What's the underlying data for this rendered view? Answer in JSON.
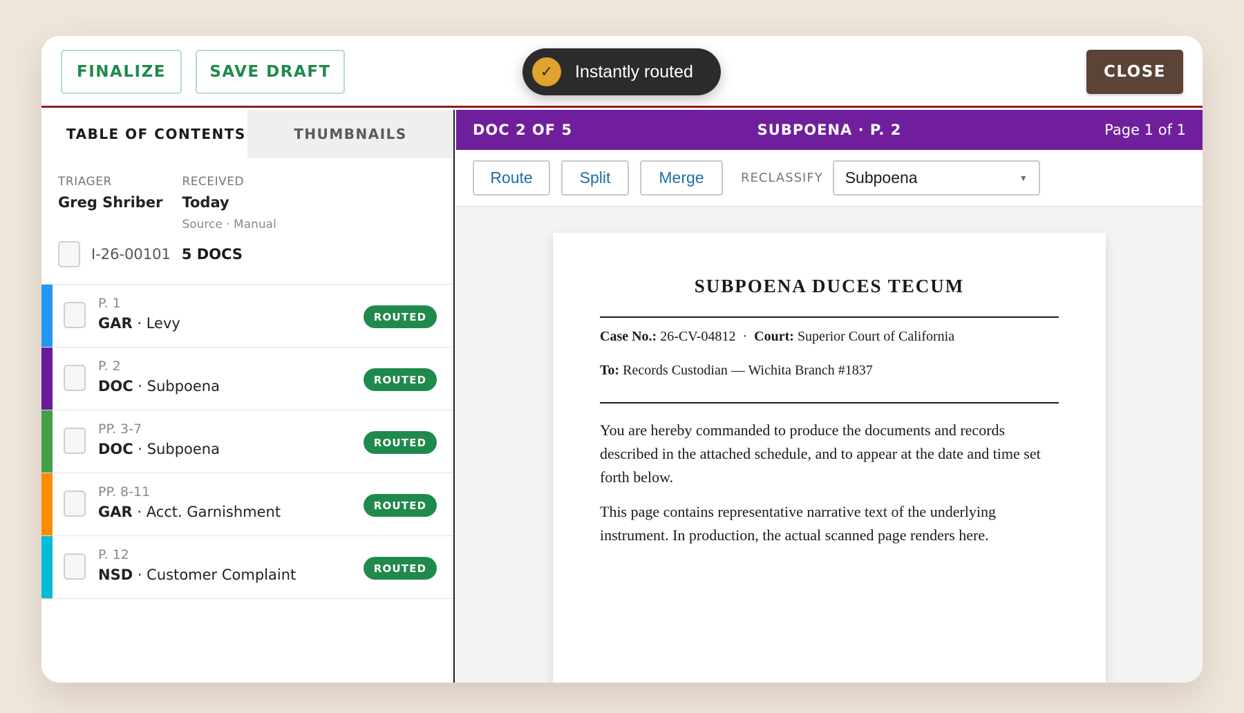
{
  "topbar": {
    "finalize_label": "FINALIZE",
    "save_label": "SAVE DRAFT",
    "close_label": "CLOSE",
    "toast_text": "Instantly routed",
    "toast_icon": "check-icon"
  },
  "sidebar": {
    "tabs": [
      {
        "label": "TABLE OF CONTENTS",
        "active": true
      },
      {
        "label": "THUMBNAILS",
        "active": false
      }
    ],
    "triager_label": "TRIAGER",
    "triager_value": "Greg Shriber",
    "received_label": "RECEIVED",
    "received_value": "Today",
    "source_text": "Source · Manual",
    "batch_id": "I-26-00101",
    "batch_count": "5 DOCS",
    "items": [
      {
        "pages": "P. 1",
        "code": "GAR",
        "type": "Levy",
        "status": "ROUTED",
        "color": "#2196f3"
      },
      {
        "pages": "P. 2",
        "code": "DOC",
        "type": "Subpoena",
        "status": "ROUTED",
        "color": "#6a1b9a"
      },
      {
        "pages": "PP. 3-7",
        "code": "DOC",
        "type": "Subpoena",
        "status": "ROUTED",
        "color": "#43a047"
      },
      {
        "pages": "PP. 8-11",
        "code": "GAR",
        "type": "Acct. Garnishment",
        "status": "ROUTED",
        "color": "#fb8c00"
      },
      {
        "pages": "P. 12",
        "code": "NSD",
        "type": "Customer Complaint",
        "status": "ROUTED",
        "color": "#00bcd4"
      }
    ]
  },
  "viewer": {
    "doc_position": "DOC 2 OF 5",
    "doc_title": "SUBPOENA · P. 2",
    "page_indicator": "Page 1 of 1",
    "header_color": "#6f1f9c",
    "route_label": "Route",
    "split_label": "Split",
    "merge_label": "Merge",
    "reclassify_label": "RECLASSIFY",
    "reclassify_value": "Subpoena"
  },
  "document": {
    "title": "SUBPOENA DUCES TECUM",
    "case_label": "Case No.:",
    "case_value": "26-CV-04812",
    "separator": "·",
    "court_label": "Court:",
    "court_value": "Superior Court of California",
    "to_label": "To:",
    "to_value": "Records Custodian — Wichita Branch #1837",
    "paragraph1": "You are hereby commanded to produce the documents and records described in the attached schedule, and to appear at the date and time set forth below.",
    "paragraph2": "This page contains representative narrative text of the underlying instrument. In production, the actual scanned page renders here."
  }
}
